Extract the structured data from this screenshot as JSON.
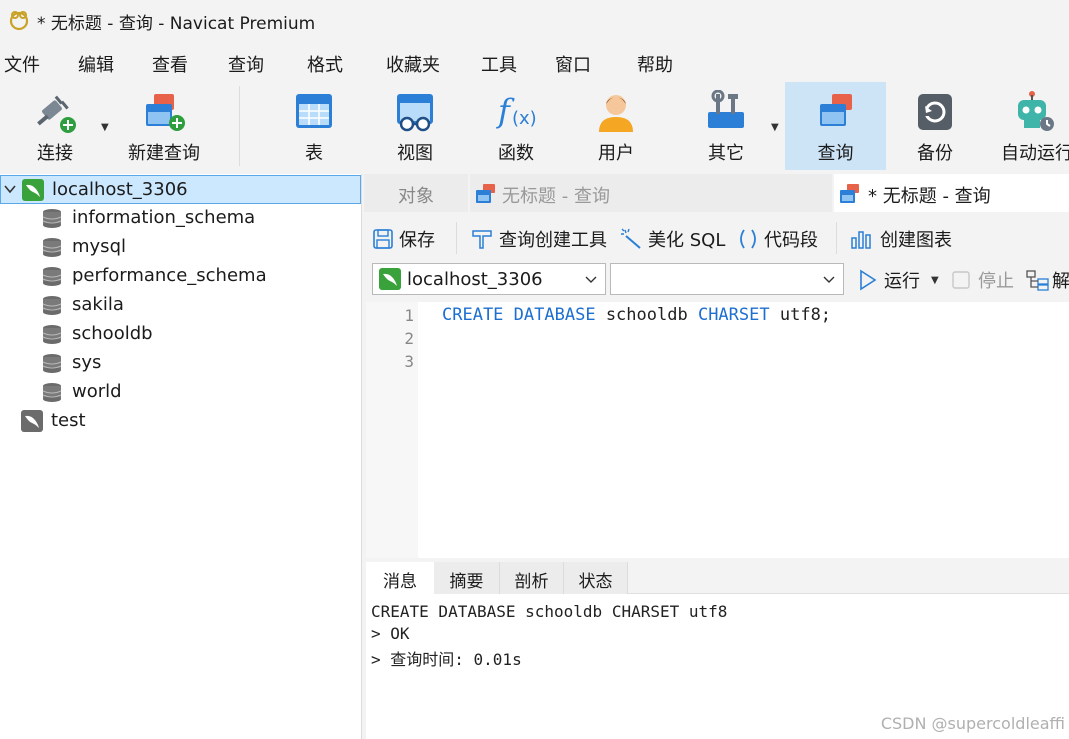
{
  "window": {
    "title": "* 无标题 - 查询 - Navicat Premium"
  },
  "menu": [
    "文件",
    "编辑",
    "查看",
    "查询",
    "格式",
    "收藏夹",
    "工具",
    "窗口",
    "帮助"
  ],
  "toolbar": {
    "connect": "连接",
    "new_query": "新建查询",
    "table": "表",
    "view": "视图",
    "function": "函数",
    "user": "用户",
    "other": "其它",
    "query": "查询",
    "backup": "备份",
    "automation": "自动运行"
  },
  "tree": {
    "connection": "localhost_3306",
    "databases": [
      "information_schema",
      "mysql",
      "performance_schema",
      "sakila",
      "schooldb",
      "sys",
      "world"
    ],
    "other_connection": "test"
  },
  "tabs": {
    "objects": "对象",
    "query_tab_1": "无标题 - 查询",
    "query_tab_2": "* 无标题 - 查询"
  },
  "query_toolbar": {
    "save": "保存",
    "query_builder": "查询创建工具",
    "beautify": "美化 SQL",
    "snippet": "代码段",
    "create_chart": "创建图表"
  },
  "selectors": {
    "connection_value": "localhost_3306",
    "database_value": "",
    "run": "运行",
    "stop": "停止",
    "explain": "解"
  },
  "editor": {
    "line_numbers": [
      "1",
      "2",
      "3"
    ],
    "kw_create": "CREATE",
    "kw_database": "DATABASE",
    "ident_db": "schooldb",
    "kw_charset": "CHARSET",
    "charset_value": "utf8;"
  },
  "result_tabs": [
    "消息",
    "摘要",
    "剖析",
    "状态"
  ],
  "output": {
    "line1": "CREATE DATABASE schooldb CHARSET utf8",
    "line2": "> OK",
    "line3": "> 查询时间: 0.01s"
  },
  "watermark": "CSDN @supercoldleaffi",
  "colors": {
    "accent": "#1c6fd1",
    "selection": "#cce8ff",
    "active_tool": "#cde4f7",
    "mysql_green": "#3aa23a"
  }
}
